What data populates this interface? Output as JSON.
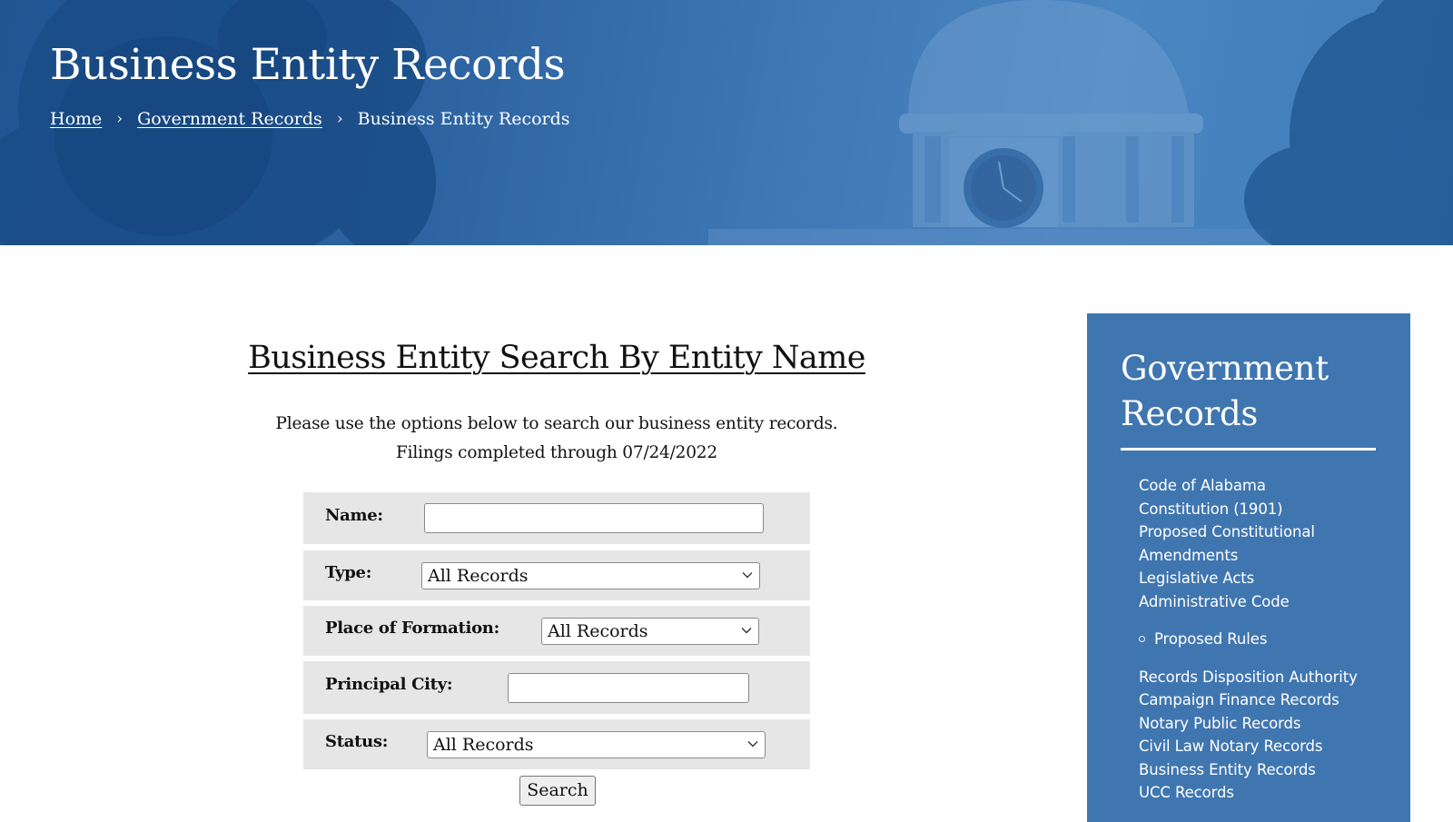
{
  "hero": {
    "title": "Business Entity Records",
    "breadcrumb": [
      {
        "label": "Home",
        "link": true
      },
      {
        "label": "Government Records",
        "link": true
      },
      {
        "label": "Business Entity Records",
        "link": false
      }
    ],
    "separator": "›"
  },
  "main": {
    "heading": "Business Entity Search By Entity Name",
    "intro_line1": "Please use the options below to search our business entity records.",
    "intro_line2": "Filings completed through 07/24/2022",
    "form": {
      "name": {
        "label": "Name:",
        "value": "",
        "placeholder": ""
      },
      "type": {
        "label": "Type:",
        "selected": "All Records"
      },
      "place_of_formation": {
        "label": "Place of Formation:",
        "selected": "All Records"
      },
      "principal_city": {
        "label": "Principal City:",
        "value": "",
        "placeholder": ""
      },
      "status": {
        "label": "Status:",
        "selected": "All Records"
      },
      "search_button": "Search"
    }
  },
  "sidebar": {
    "title_line1": "Government",
    "title_line2": "Records",
    "items": [
      "Code of Alabama",
      "Constitution (1901)",
      "Proposed Constitutional Amendments",
      "Legislative Acts",
      "Administrative Code"
    ],
    "sub_items": [
      "Proposed Rules"
    ],
    "items_after": [
      "Records Disposition Authority",
      "Campaign Finance Records",
      "Notary Public Records",
      "Civil Law Notary Records",
      "Business Entity Records",
      "UCC Records"
    ]
  },
  "colors": {
    "hero_blue": "#2c63a0",
    "sidebar_blue": "#4076b0",
    "form_row_bg": "#e6e6e6",
    "text": "#111111",
    "white": "#ffffff"
  }
}
